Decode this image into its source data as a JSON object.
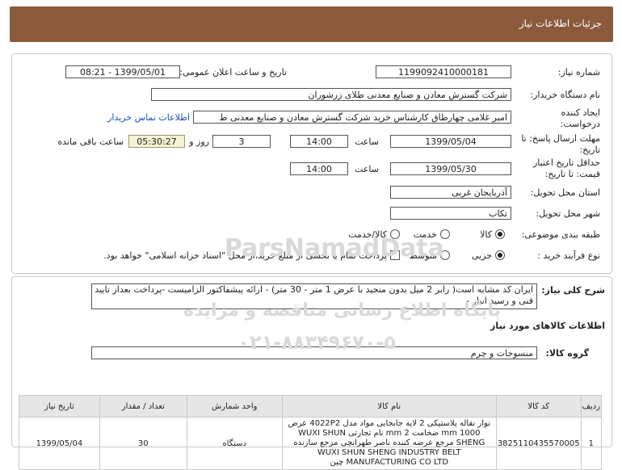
{
  "header": {
    "title": "جزئیات اطلاعات نیاز"
  },
  "form": {
    "need_number_label": "شماره نیاز:",
    "need_number": "1199092410000181",
    "announce_label": "تاریخ و ساعت اعلان عمومی:",
    "announce_value": "1399/05/01 - 08:21",
    "buyer_label": "نام دستگاه خریدار:",
    "buyer_value": "شرکت گسترش معادن و صنایع معدنی طلای زرشوران",
    "requester_label": "ایجاد کننده درخواست:",
    "requester_value": "امیر غلامی چهارطاق کارشناس خرید شرکت گسترش معادن و صنایع معدنی ط",
    "contact_link": "اطلاعات تماس خریدار",
    "send_deadline_label": "مهلت ارسال پاسخ: تا تاریخ:",
    "send_date": "1399/05/04",
    "time_label": "ساعت",
    "send_time": "14:00",
    "days_value": "3",
    "days_label": "روز و",
    "timer_value": "05:30:27",
    "remaining_label": "ساعت باقی مانده",
    "price_validity_label": "حداقل تاریخ اعتبار قیمت: تا تاریخ:",
    "validity_date": "1399/05/30",
    "validity_time": "14:00",
    "province_label": "استان محل تحویل:",
    "province_value": "آذربایجان غربی",
    "city_label": "شهر محل تحویل:",
    "city_value": "تکاب",
    "category_label": "طبقه بندی موضوعی:",
    "category_options": [
      "کالا",
      "خدمت",
      "کالا/خدمت"
    ],
    "category_selected": 0,
    "process_label": "نوع فرآیند خرید :",
    "process_options": [
      "جزیی",
      "متوسط"
    ],
    "process_selected": 0,
    "payment_note": "پرداخت تمام یا بخشی از مبلغ خرید،از محل \"اسناد خزانه اسلامی\" خواهد بود."
  },
  "details": {
    "general_desc_label": "شرح کلی نیاز:",
    "general_desc": "ایران کد مشابه است( رابر 2 میل بدون منجید با عرض 1 متر - 30 متر) - ارائه پیشفاکتور الزامیست -پرداخت بعداز تایید فنی و رسید انبار -",
    "goods_info_title": "اطلاعات کالاهای مورد نیاز",
    "goods_group_label": "گروه کالا:",
    "goods_group_value": "منسوجات و چرم",
    "table": {
      "headers": [
        "ردیف",
        "کد کالا",
        "نام کالا",
        "واحد شمارش",
        "تعداد / مقدار",
        "تاریخ نیاز"
      ],
      "rows": [
        {
          "row": "1",
          "code": "3825110435570005",
          "name": "نوار نقاله پلاستیکی 2 لایه جابجایی مواد مدل 4022P2 عرض 1000 mm ضخامت 2 mm نام تجارتی WUXI SHUN SHENG مرجع عرضه کننده ناصر طهرانچی مرجع سازنده WUXI SHUN SHENG INDUSTRY BELT MANUFACTURING CO LTD چین",
          "unit": "دستگاه",
          "qty": "30",
          "date": "1399/05/04"
        }
      ]
    }
  },
  "watermark": {
    "brand": "ParsNamadData",
    "line1": "پایگاه اطلاع رسانی مناقصه و مزایده",
    "phone": "۰۲۱-۸۸۳۴۹۶۷۰-۵"
  }
}
